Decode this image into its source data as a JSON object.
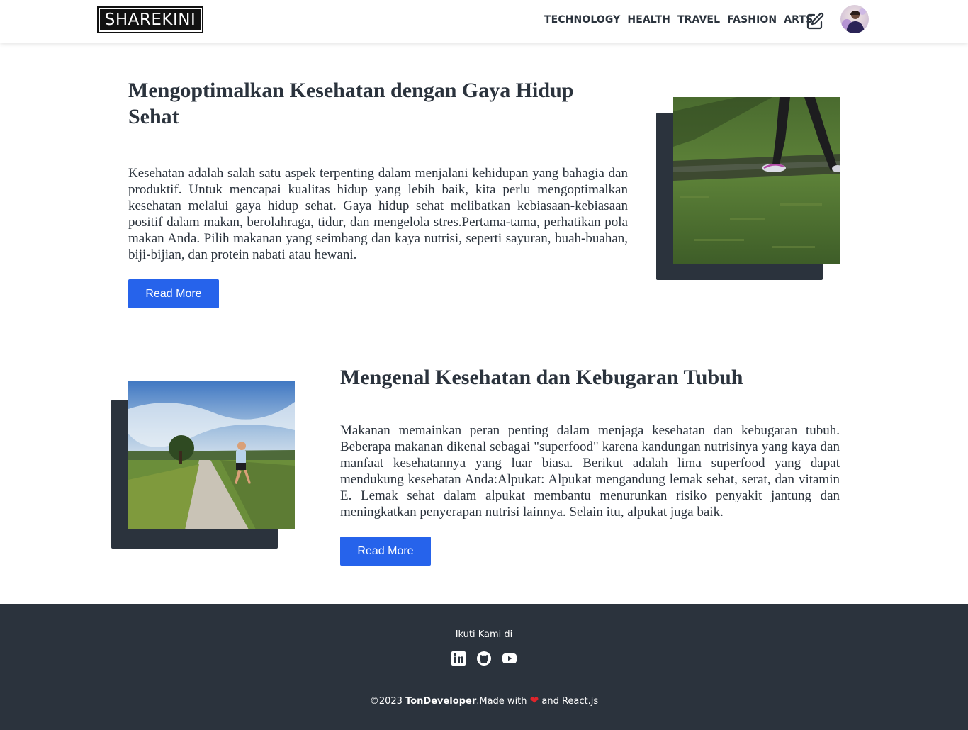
{
  "navbar": {
    "logo_text": "SHAREKINI",
    "links": [
      "TECHNOLOGY",
      "HEALTH",
      "TRAVEL",
      "FASHION",
      "ARTS"
    ]
  },
  "articles": [
    {
      "title": "Mengoptimalkan Kesehatan dengan Gaya Hidup Sehat",
      "excerpt": "Kesehatan adalah salah satu aspek terpenting dalam menjalani kehidupan yang bahagia dan produktif. Untuk mencapai kualitas hidup yang lebih baik, kita perlu mengoptimalkan kesehatan melalui gaya hidup sehat. Gaya hidup sehat melibatkan kebiasaan-kebiasaan positif dalam makan, berolahraga, tidur, dan mengelola stres.Pertama-tama, perhatikan pola makan Anda. Pilih makanan yang seimbang dan kaya nutrisi, seperti sayuran, buah-buahan, biji-bijian, dan protein nabati atau hewani.",
      "button_label": "Read More"
    },
    {
      "title": "Mengenal Kesehatan dan Kebugaran Tubuh",
      "excerpt": "Makanan memainkan peran penting dalam menjaga kesehatan dan kebugaran tubuh. Beberapa makanan dikenal sebagai \"superfood\" karena kandungan nutrisinya yang kaya dan manfaat kesehatannya yang luar biasa. Berikut adalah lima superfood yang dapat mendukung kesehatan Anda:Alpukat: Alpukat mengandung lemak sehat, serat, dan vitamin E. Lemak sehat dalam alpukat membantu menurunkan risiko penyakit jantung dan meningkatkan penyerapan nutrisi lainnya. Selain itu, alpukat juga baik.",
      "button_label": "Read More"
    }
  ],
  "footer": {
    "follow_text": "Ikuti Kami di",
    "social_icons": [
      "linkedin-icon",
      "github-icon",
      "youtube-icon"
    ],
    "copyright_prefix": "©2023 ",
    "brand": "TonDeveloper",
    "made_with": ".Made with ",
    "suffix": " and React.js"
  },
  "colors": {
    "dark": "#2b333d",
    "accent": "#2663eb",
    "heart": "#e0242b"
  }
}
